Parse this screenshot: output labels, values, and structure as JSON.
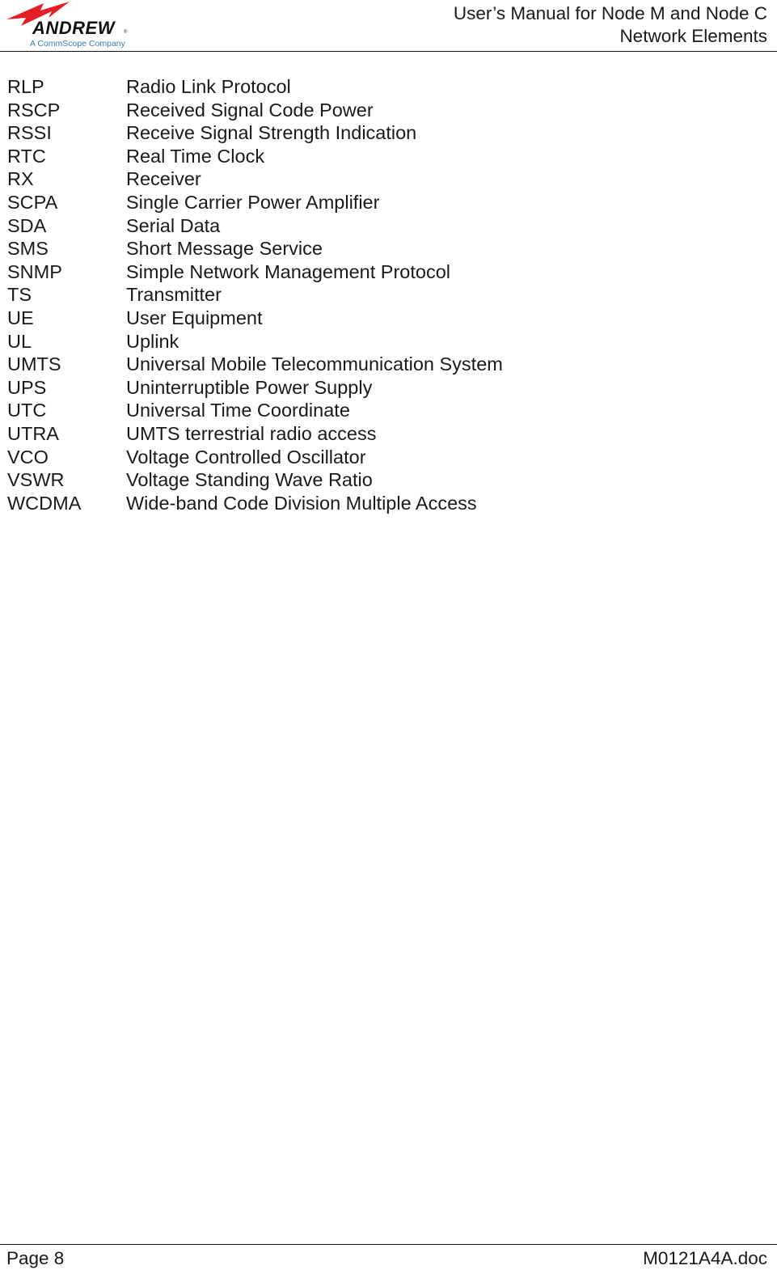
{
  "header": {
    "logo": {
      "icon": "lightning-bolt-icon",
      "brand": "ANDREW",
      "registered": "®",
      "tagline": "A CommScope Company",
      "bolt_color": "#e31e24",
      "tagline_color": "#3d7bb5"
    },
    "title_line1": "User’s Manual for Node M and Node C",
    "title_line2": "Network Elements"
  },
  "glossary": [
    {
      "abbr": "RLP",
      "definition": "Radio Link Protocol"
    },
    {
      "abbr": "RSCP",
      "definition": "Received Signal Code Power"
    },
    {
      "abbr": "RSSI",
      "definition": "Receive Signal Strength Indication"
    },
    {
      "abbr": "RTC",
      "definition": "Real Time Clock"
    },
    {
      "abbr": "RX",
      "definition": "Receiver"
    },
    {
      "abbr": "SCPA",
      "definition": "Single Carrier Power Amplifier"
    },
    {
      "abbr": "SDA",
      "definition": "Serial Data"
    },
    {
      "abbr": "SMS",
      "definition": "Short Message Service"
    },
    {
      "abbr": "SNMP",
      "definition": "Simple Network Management Protocol"
    },
    {
      "abbr": "TS",
      "definition": "Transmitter"
    },
    {
      "abbr": "UE",
      "definition": "User Equipment"
    },
    {
      "abbr": "UL",
      "definition": "Uplink"
    },
    {
      "abbr": "UMTS",
      "definition": "Universal Mobile Telecommunication System"
    },
    {
      "abbr": "UPS",
      "definition": "Uninterruptible Power Supply"
    },
    {
      "abbr": "UTC",
      "definition": "Universal Time Coordinate"
    },
    {
      "abbr": "UTRA",
      "definition": "UMTS terrestrial radio access"
    },
    {
      "abbr": "VCO",
      "definition": "Voltage Controlled Oscillator"
    },
    {
      "abbr": "VSWR",
      "definition": "Voltage Standing Wave Ratio"
    },
    {
      "abbr": "WCDMA",
      "definition": "Wide-band Code Division Multiple Access"
    }
  ],
  "footer": {
    "page_label": "Page 8",
    "doc_name": "M0121A4A.doc"
  }
}
